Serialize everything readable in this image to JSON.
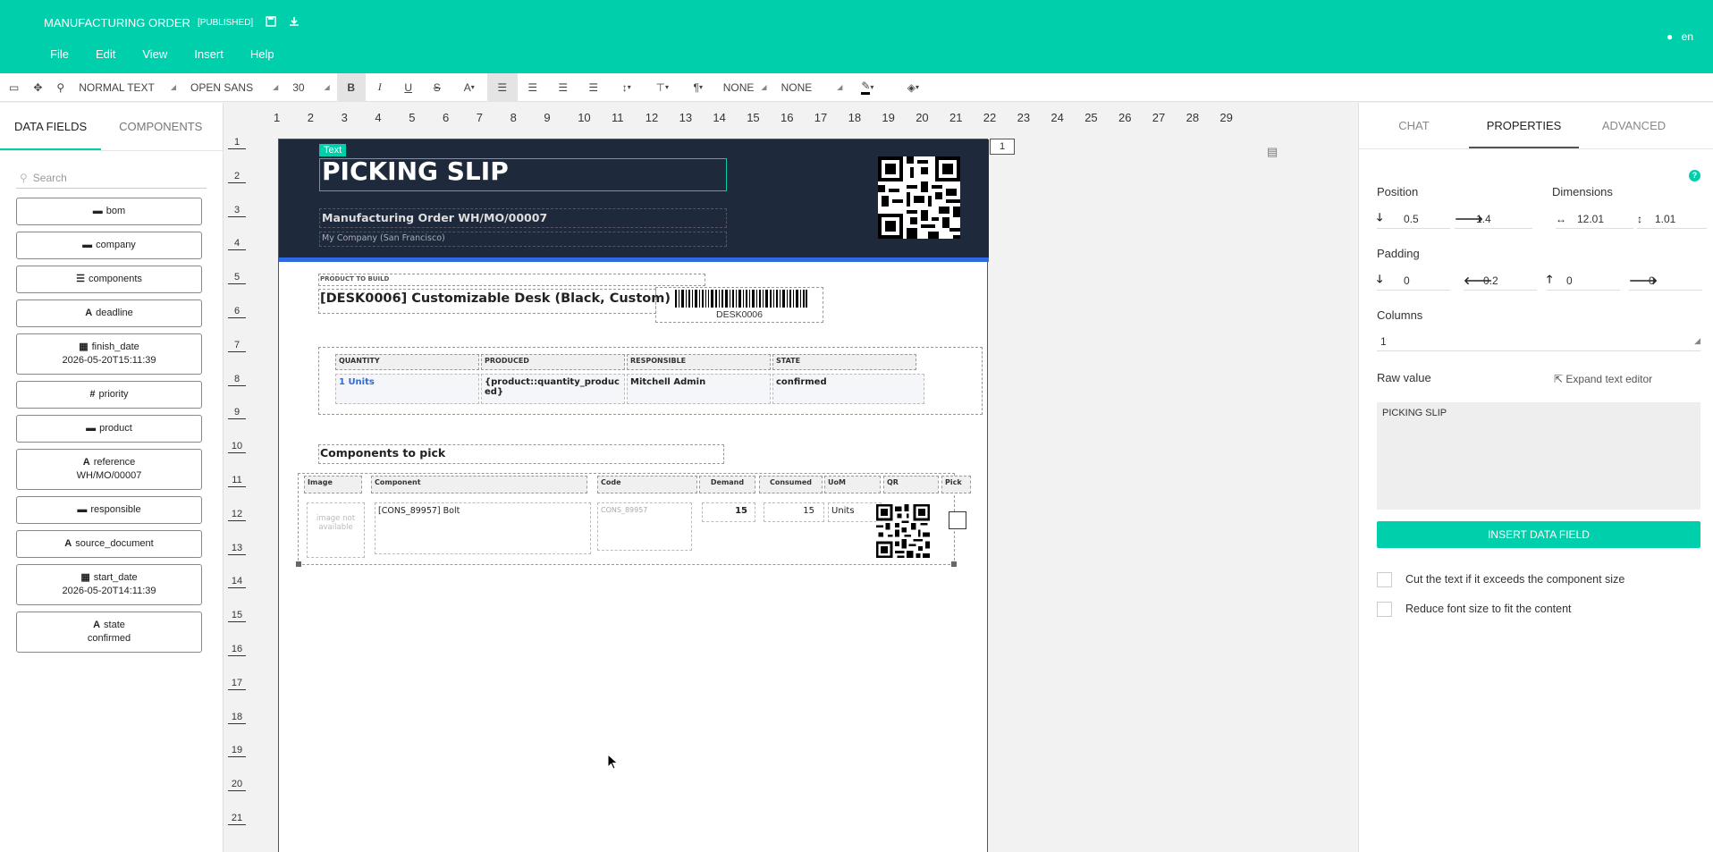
{
  "app": {
    "title": "MANUFACTURING ORDER",
    "status": "[PUBLISHED]",
    "lang": "en"
  },
  "menu": [
    "File",
    "Edit",
    "View",
    "Insert",
    "Help"
  ],
  "toolbar": {
    "style": "NORMAL TEXT",
    "font": "OPEN SANS",
    "size": "30",
    "border1": "NONE",
    "border2": "NONE",
    "align_icon": "align-left"
  },
  "left": {
    "tabs": [
      "DATA FIELDS",
      "COMPONENTS"
    ],
    "search_placeholder": "Search",
    "fields": [
      {
        "icon": "folder-icon",
        "glyph": "▬",
        "label": "bom",
        "value": ""
      },
      {
        "icon": "folder-icon",
        "glyph": "▬",
        "label": "company",
        "value": ""
      },
      {
        "icon": "list-icon",
        "glyph": "☰",
        "label": "components",
        "value": ""
      },
      {
        "icon": "text-icon",
        "glyph": "A",
        "label": "deadline",
        "value": ""
      },
      {
        "icon": "calendar-icon",
        "glyph": "▦",
        "label": "finish_date",
        "value": "2026-05-20T15:11:39"
      },
      {
        "icon": "hash-icon",
        "glyph": "#",
        "label": "priority",
        "value": ""
      },
      {
        "icon": "folder-icon",
        "glyph": "▬",
        "label": "product",
        "value": ""
      },
      {
        "icon": "text-icon",
        "glyph": "A",
        "label": "reference",
        "value": "WH/MO/00007"
      },
      {
        "icon": "folder-icon",
        "glyph": "▬",
        "label": "responsible",
        "value": ""
      },
      {
        "icon": "text-icon",
        "glyph": "A",
        "label": "source_document",
        "value": ""
      },
      {
        "icon": "calendar-icon",
        "glyph": "▦",
        "label": "start_date",
        "value": "2026-05-20T14:11:39"
      },
      {
        "icon": "text-icon",
        "glyph": "A",
        "label": "state",
        "value": "confirmed"
      }
    ]
  },
  "right": {
    "tabs": [
      "CHAT",
      "PROPERTIES",
      "ADVANCED"
    ],
    "position_label": "Position",
    "dimensions_label": "Dimensions",
    "pos_y": "0.5",
    "pos_x": "1.4",
    "width": "12.01",
    "height": "1.01",
    "padding_label": "Padding",
    "pad_down": "0",
    "pad_left": "0.2",
    "pad_up": "0",
    "pad_right": "0",
    "columns_label": "Columns",
    "columns": "1",
    "raw_label": "Raw value",
    "expand_label": "Expand text editor",
    "raw_value": "PICKING SLIP",
    "insert_button": "INSERT DATA FIELD",
    "cut_text": "Cut the text if it exceeds the component size",
    "reduce_font": "Reduce font size to fit the content"
  },
  "ruler": {
    "h": [
      "1",
      "2",
      "3",
      "4",
      "5",
      "6",
      "7",
      "8",
      "9",
      "10",
      "11",
      "12",
      "13",
      "14",
      "15",
      "16",
      "17",
      "18",
      "19",
      "20",
      "21",
      "22",
      "23",
      "24",
      "25",
      "26",
      "27",
      "28",
      "29"
    ],
    "v": [
      "1",
      "2",
      "3",
      "4",
      "5",
      "6",
      "7",
      "8",
      "9",
      "10",
      "11",
      "12",
      "13",
      "14",
      "15",
      "16",
      "17",
      "18",
      "19",
      "20",
      "21"
    ],
    "page_num": "1"
  },
  "doc": {
    "selected_label": "Text",
    "title": "PICKING SLIP",
    "subtitle": "Manufacturing Order WH/MO/00007",
    "company": "My Company (San Francisco)",
    "product_label": "PRODUCT TO BUILD",
    "product": "[DESK0006] Customizable Desk (Black, Custom)",
    "barcode": "DESK0006",
    "info_headers": [
      "QUANTITY",
      "PRODUCED",
      "RESPONSIBLE",
      "STATE"
    ],
    "info_values": [
      "1 Units",
      "{product::quantity_produced}",
      "Mitchell Admin",
      "confirmed"
    ],
    "components_title": "Components to pick",
    "comp_headers": [
      "Image",
      "Component",
      "Code",
      "Demand",
      "Consumed",
      "UoM",
      "QR",
      "Pick"
    ],
    "comp_row": {
      "image": "image not available",
      "component": "[CONS_89957] Bolt",
      "code": "CONS_89957",
      "demand": "15",
      "consumed": "15",
      "uom": "Units"
    }
  }
}
